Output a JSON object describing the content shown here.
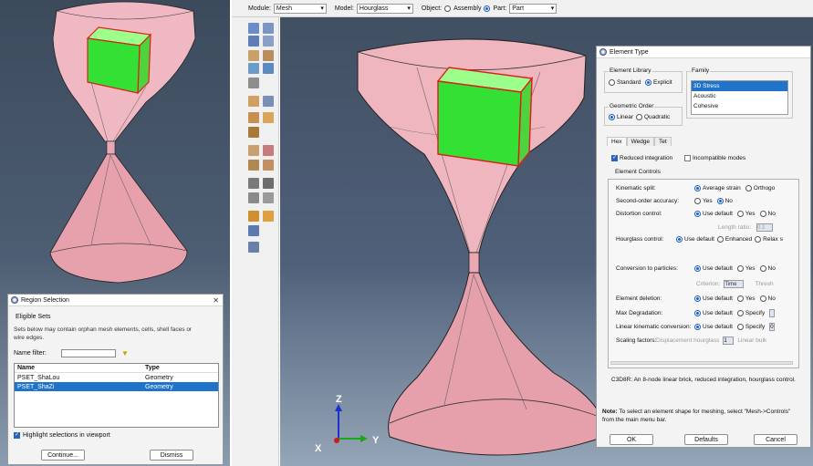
{
  "region_selection": {
    "title": "Region Selection",
    "section": "Eligible Sets",
    "note": "Sets below may contain orphan mesh elements, cells, shell faces or wire edges.",
    "name_filter_label": "Name filter:",
    "columns": [
      "Name",
      "Type"
    ],
    "rows": [
      {
        "name": "PSET_ShaLou",
        "type": "Geometry"
      },
      {
        "name": "PSET_ShaZi",
        "type": "Geometry"
      }
    ],
    "highlight_label": "Highlight selections in viewport",
    "continue_label": "Continue...",
    "dismiss_label": "Dismiss"
  },
  "toolbar": {
    "module_label": "Module:",
    "module_value": "Mesh",
    "model_label": "Model:",
    "model_value": "Hourglass",
    "object_label": "Object:",
    "assembly_label": "Assembly",
    "part_label": "Part:",
    "part_value": "Part"
  },
  "triad": {
    "z": "Z",
    "x": "X",
    "y": "Y"
  },
  "element_type": {
    "title": "Element Type",
    "library_legend": "Element Library",
    "library_options": [
      "Standard",
      "Explicit"
    ],
    "family_legend": "Family",
    "family_items": [
      "3D Stress",
      "Acoustic",
      "Cohesive"
    ],
    "geometric_order_legend": "Geometric Order",
    "order_options": [
      "Linear",
      "Quadratic"
    ],
    "tabs": [
      "Hex",
      "Wedge",
      "Tet"
    ],
    "reduced_integration": "Reduced integration",
    "incompatible_modes": "Incompatible modes",
    "element_controls": "Element Controls",
    "controls": {
      "kinematic_split": {
        "label": "Kinematic split:",
        "opt1": "Average strain",
        "opt2": "Orthogo"
      },
      "second_order": {
        "label": "Second-order accuracy:",
        "opt1": "Yes",
        "opt2": "No"
      },
      "distortion": {
        "label": "Distortion control:",
        "opt1": "Use default",
        "opt2": "Yes",
        "opt3": "No"
      },
      "length_ratio": {
        "label": "Length ratio:",
        "value": "0.1"
      },
      "hourglass": {
        "label": "Hourglass control:",
        "opt1": "Use default",
        "opt2": "Enhanced",
        "opt3": "Relax s"
      },
      "conversion": {
        "label": "Conversion to particles:",
        "opt1": "Use default",
        "opt2": "Yes",
        "opt3": "No"
      },
      "criterion": {
        "label": "Criterion:",
        "value": "Time",
        "extra": "Thresh"
      },
      "deletion": {
        "label": "Element deletion:",
        "opt1": "Use default",
        "opt2": "Yes",
        "opt3": "No"
      },
      "max_degradation": {
        "label": "Max Degradation:",
        "opt1": "Use default",
        "opt2": "Specify"
      },
      "linear_kinematic": {
        "label": "Linear kinematic conversion:",
        "opt1": "Use default",
        "opt2": "Specify",
        "value": "0"
      },
      "scaling": {
        "label": "Scaling factors:",
        "sub": "Displacement hourglass",
        "value": "1",
        "extra": "Linear bulk"
      }
    },
    "description": "C3D8R:  An 8-node linear brick, reduced integration, hourglass control.",
    "note_label": "Note:",
    "note_text": "To select an element shape for meshing, select \"Mesh->Controls\" from the main menu bar.",
    "ok_label": "OK",
    "defaults_label": "Defaults",
    "cancel_label": "Cancel"
  }
}
